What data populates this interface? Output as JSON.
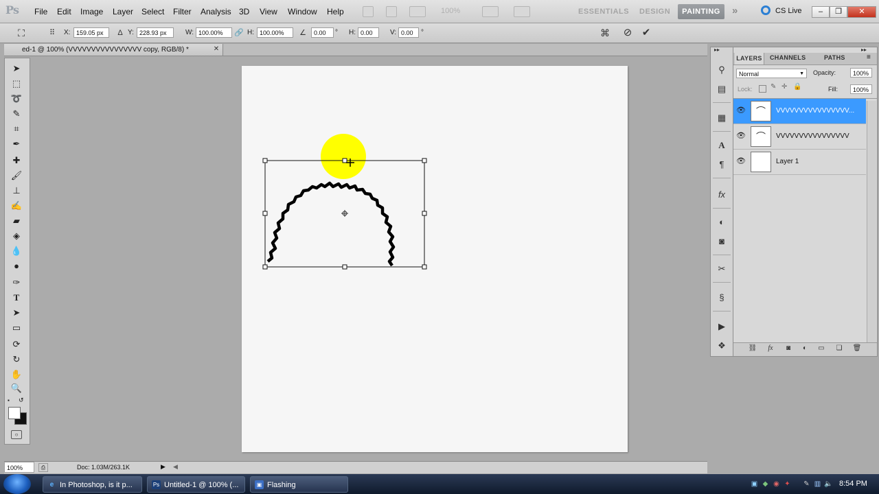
{
  "app": {
    "logo": "Ps",
    "menu": [
      "File",
      "Edit",
      "Image",
      "Layer",
      "Select",
      "Filter",
      "Analysis",
      "3D",
      "View",
      "Window",
      "Help"
    ],
    "zoom_dim": "100%",
    "workspaces": {
      "essentials": "ESSENTIALS",
      "design": "DESIGN",
      "painting": "PAINTING",
      "more": "»"
    },
    "cs_live": "CS Live",
    "window_buttons": {
      "minimize": "–",
      "restore": "❐",
      "close": "✕"
    }
  },
  "options": {
    "x_label": "X:",
    "x_value": "159.05 px",
    "y_label": "Y:",
    "y_value": "228.93 px",
    "w_label": "W:",
    "w_value": "100.00%",
    "h_label": "H:",
    "h_value": "100.00%",
    "angle_value": "0.00",
    "angle_unit": "°",
    "hskew_label": "H:",
    "hskew_value": "0.00",
    "vskew_label": "V:",
    "vskew_value": "0.00",
    "vskew_unit": "°"
  },
  "document": {
    "tab_title": "ed-1 @ 100% (VVVVVVVVVVVVVVVV copy, RGB/8) *",
    "close": "✕"
  },
  "status": {
    "zoom": "100%",
    "doc_info": "Doc: 1.03M/263.1K"
  },
  "layers_panel": {
    "tabs": [
      "LAYERS",
      "CHANNELS",
      "PATHS"
    ],
    "blend_mode": "Normal",
    "opacity_label": "Opacity:",
    "opacity_value": "100%",
    "lock_label": "Lock:",
    "fill_label": "Fill:",
    "fill_value": "100%",
    "layers": [
      {
        "name": "VVVVVVVVVVVVVVVV...",
        "selected": true
      },
      {
        "name": "VVVVVVVVVVVVVVVV",
        "selected": false
      },
      {
        "name": "Layer 1",
        "selected": false
      }
    ]
  },
  "taskbar": {
    "tasks": [
      {
        "label": "In Photoshop, is it p...",
        "icon": "ie-icon"
      },
      {
        "label": "Untitled-1 @ 100% (...",
        "icon": "photoshop-icon"
      },
      {
        "label": "Flashing",
        "icon": "window-icon"
      }
    ],
    "clock": "8:54 PM"
  },
  "colors": {
    "highlight": "#ffff00",
    "selected_layer": "#3b9aff",
    "canvas": "#f6f6f6"
  }
}
